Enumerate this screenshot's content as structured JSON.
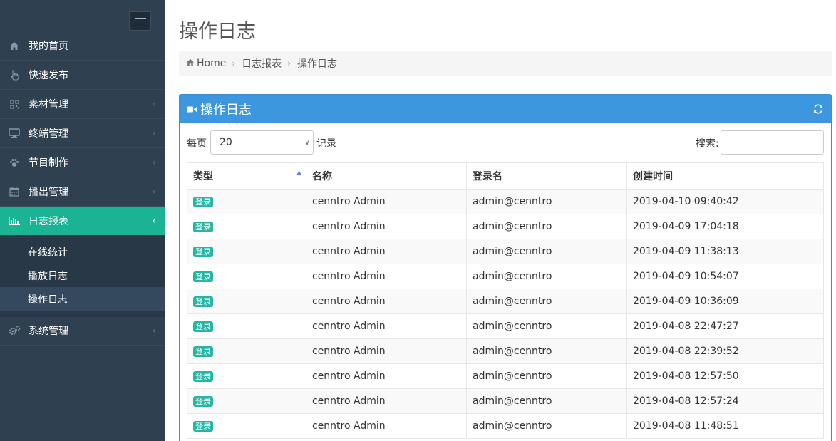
{
  "sidebar": {
    "items": [
      {
        "label": "我的首页",
        "icon": "home-icon"
      },
      {
        "label": "快速发布",
        "icon": "hand-pointer-icon"
      },
      {
        "label": "素材管理",
        "icon": "qrcode-icon"
      },
      {
        "label": "终端管理",
        "icon": "desktop-icon"
      },
      {
        "label": "节目制作",
        "icon": "paw-icon"
      },
      {
        "label": "播出管理",
        "icon": "calendar-icon"
      },
      {
        "label": "日志报表",
        "icon": "bar-chart-icon"
      },
      {
        "label": "系统管理",
        "icon": "cogs-icon"
      }
    ],
    "sub_items": [
      {
        "label": "在线统计"
      },
      {
        "label": "播放日志"
      },
      {
        "label": "操作日志"
      }
    ],
    "active_color": "#1ab394"
  },
  "page": {
    "title": "操作日志"
  },
  "breadcrumb": {
    "home": "Home",
    "level1": "日志报表",
    "level2": "操作日志"
  },
  "panel": {
    "title": "操作日志",
    "header_color": "#3c97de"
  },
  "controls": {
    "per_page_label": "每页",
    "per_page_value": "20",
    "records_label": "记录",
    "search_label": "搜索:"
  },
  "table": {
    "headers": [
      "类型",
      "名称",
      "登录名",
      "创建时间"
    ],
    "rows": [
      {
        "type": "登录",
        "name": "cenntro Admin",
        "login": "admin@cenntro",
        "time": "2019-04-10 09:40:42"
      },
      {
        "type": "登录",
        "name": "cenntro Admin",
        "login": "admin@cenntro",
        "time": "2019-04-09 17:04:18"
      },
      {
        "type": "登录",
        "name": "cenntro Admin",
        "login": "admin@cenntro",
        "time": "2019-04-09 11:38:13"
      },
      {
        "type": "登录",
        "name": "cenntro Admin",
        "login": "admin@cenntro",
        "time": "2019-04-09 10:54:07"
      },
      {
        "type": "登录",
        "name": "cenntro Admin",
        "login": "admin@cenntro",
        "time": "2019-04-09 10:36:09"
      },
      {
        "type": "登录",
        "name": "cenntro Admin",
        "login": "admin@cenntro",
        "time": "2019-04-08 22:47:27"
      },
      {
        "type": "登录",
        "name": "cenntro Admin",
        "login": "admin@cenntro",
        "time": "2019-04-08 22:39:52"
      },
      {
        "type": "登录",
        "name": "cenntro Admin",
        "login": "admin@cenntro",
        "time": "2019-04-08 12:57:50"
      },
      {
        "type": "登录",
        "name": "cenntro Admin",
        "login": "admin@cenntro",
        "time": "2019-04-08 12:57:24"
      },
      {
        "type": "登录",
        "name": "cenntro Admin",
        "login": "admin@cenntro",
        "time": "2019-04-08 11:48:51"
      }
    ]
  }
}
